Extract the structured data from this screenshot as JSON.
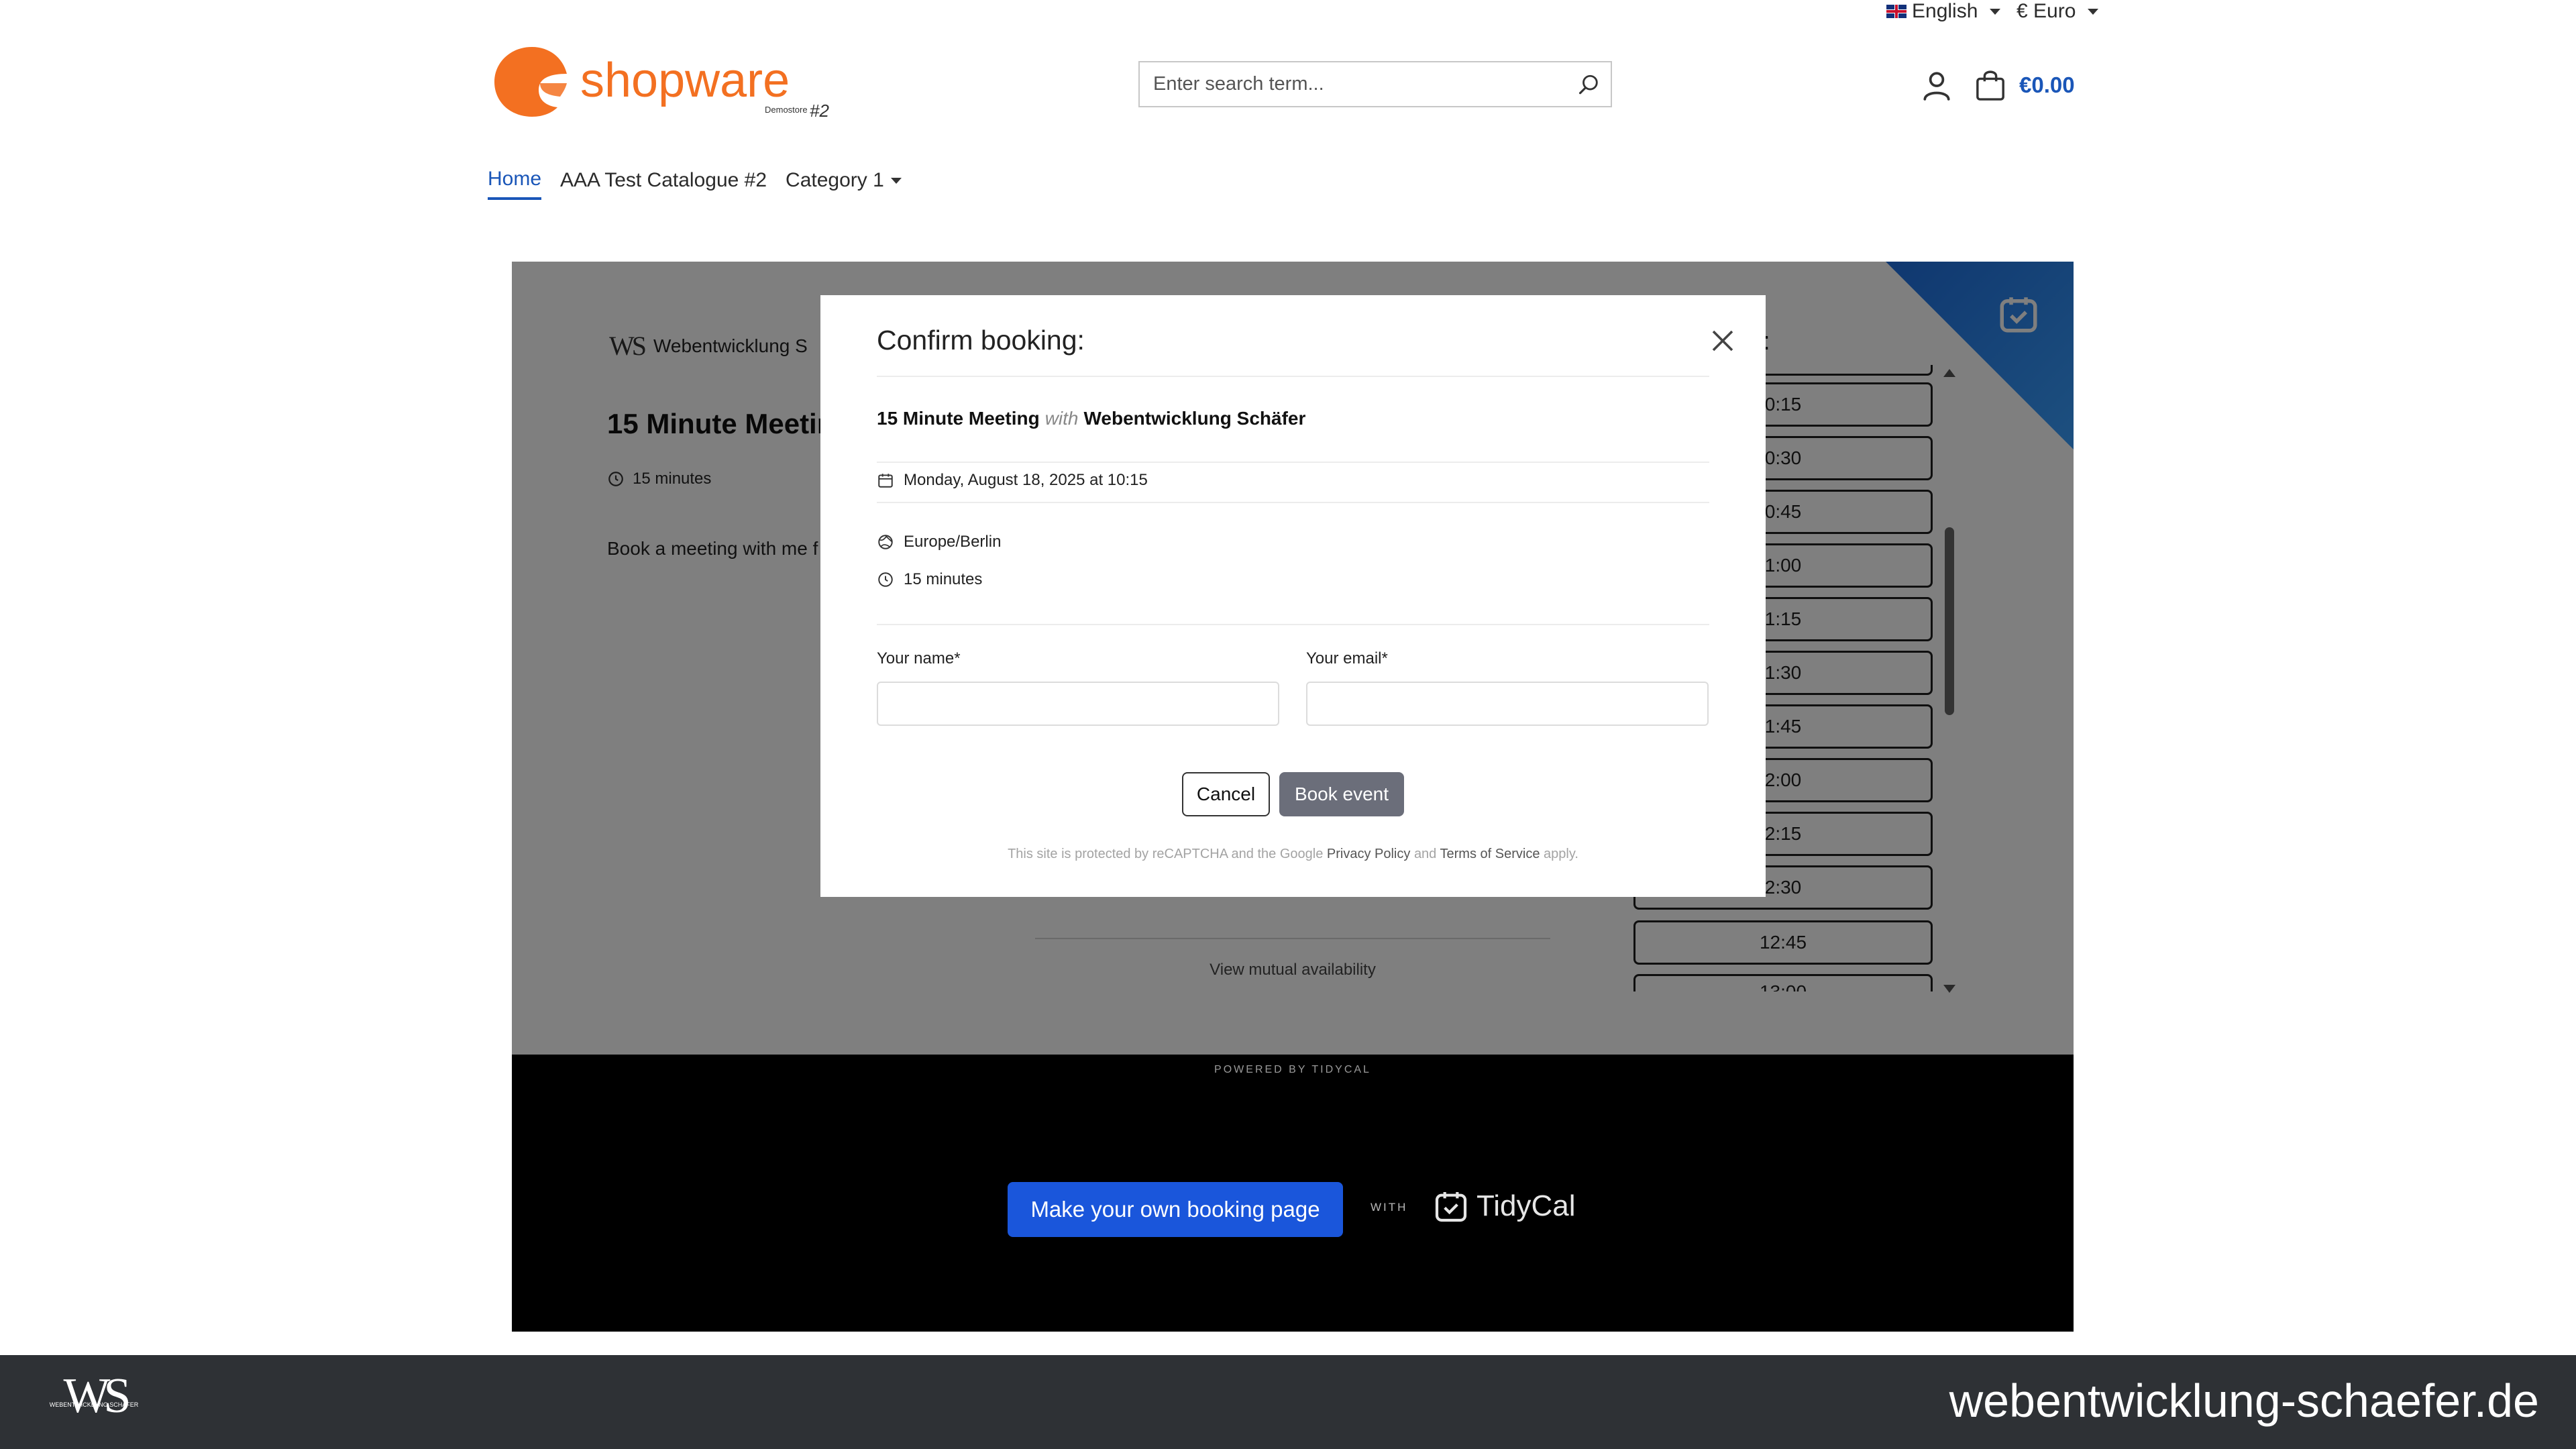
{
  "header": {
    "language": "English",
    "currency": "€ Euro",
    "search_placeholder": "Enter search term...",
    "cart_total": "€0.00",
    "logo_text": "shopware",
    "logo_small": "Demostore",
    "logo_number": "#2"
  },
  "nav": {
    "items": [
      {
        "label": "Home",
        "active": true
      },
      {
        "label": "AAA Test Catalogue #2"
      },
      {
        "label": "Category 1"
      }
    ]
  },
  "embed": {
    "host_name": "Webentwicklung S",
    "meeting_title": "15 Minute Meetin",
    "duration": "15 minutes",
    "description": "Book a meeting with me f",
    "slots_header": "e:",
    "slots": [
      "0:15",
      "0:30",
      "0:45",
      "1:00",
      "1:15",
      "1:30",
      "1:45",
      "2:00",
      "2:15",
      "2:30",
      "12:45",
      "13:00"
    ],
    "mutual_availability": "View mutual availability",
    "powered_by": "POWERED BY TIDYCAL",
    "make_own_label": "Make your own booking page",
    "with_label": "WITH",
    "tidycal_brand": "TidyCal"
  },
  "modal": {
    "title": "Confirm booking:",
    "meeting_name": "15 Minute Meeting",
    "with_word": "with",
    "host": "Webentwicklung Schäfer",
    "datetime": "Monday, August 18, 2025 at 10:15",
    "timezone": "Europe/Berlin",
    "duration": "15 minutes",
    "name_label": "Your name*",
    "email_label": "Your email*",
    "cancel_label": "Cancel",
    "book_label": "Book event",
    "recaptcha_pre": "This site is protected by reCAPTCHA and the Google",
    "privacy_label": "Privacy Policy",
    "and_word": "and",
    "terms_label": "Terms of Service",
    "apply_word": "apply."
  },
  "footer": {
    "domain": "webentwicklung-schaefer.de",
    "logo_caption": "WEBENTWICKLUNG SCHÄFER"
  },
  "colors": {
    "brand_orange": "#f37021",
    "accent_blue": "#1a56b8",
    "tidycal_blue": "#1a56db",
    "bottom_bar": "#2e3135"
  }
}
